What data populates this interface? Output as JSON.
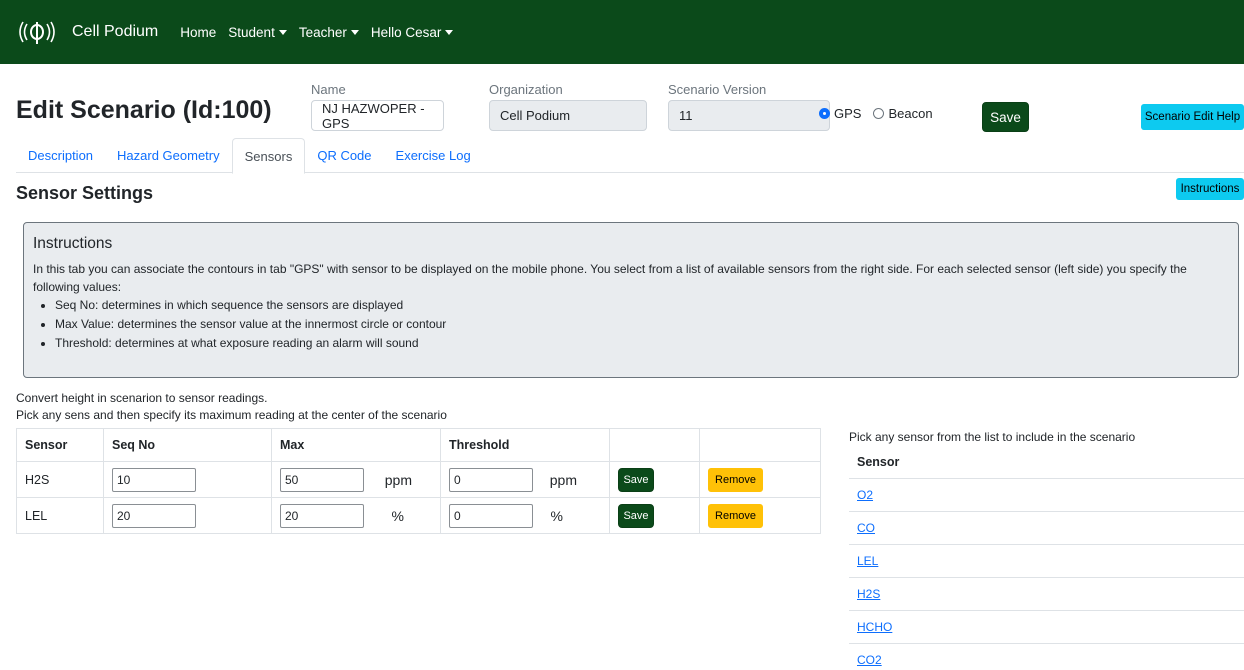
{
  "nav": {
    "brand": "Cell Podium",
    "items": [
      {
        "label": "Home",
        "dropdown": false
      },
      {
        "label": "Student",
        "dropdown": true
      },
      {
        "label": "Teacher",
        "dropdown": true
      },
      {
        "label": "Hello Cesar",
        "dropdown": true
      }
    ],
    "logo_icon": "signal-broadcast-icon"
  },
  "header": {
    "title": "Edit Scenario (Id:100)",
    "name_label": "Name",
    "name_value": "NJ HAZWOPER - GPS",
    "org_label": "Organization",
    "org_value": "Cell Podium",
    "version_label": "Scenario Version",
    "version_value": "11",
    "radio_gps": "GPS",
    "radio_beacon": "Beacon",
    "selected_mode": "GPS",
    "save_label": "Save",
    "help_label": "Scenario Edit Help"
  },
  "tabs": [
    {
      "label": "Description",
      "active": false
    },
    {
      "label": "Hazard Geometry",
      "active": false
    },
    {
      "label": "Sensors",
      "active": true
    },
    {
      "label": "QR Code",
      "active": false
    },
    {
      "label": "Exercise Log",
      "active": false
    }
  ],
  "section": {
    "title": "Sensor Settings",
    "instructions_button": "Instructions"
  },
  "instructions": {
    "title": "Instructions",
    "text": "In this tab you can associate the contours in tab \"GPS\" with sensor to be displayed on the mobile phone. You select from a list of available sensors from the right side. For each selected sensor (left side) you specify the following values:",
    "bullets": [
      "Seq No: determines in which sequence the sensors are displayed",
      "Max Value: determines the sensor value at the innermost circle or contour",
      "Threshold: determines at what exposure reading an alarm will sound"
    ]
  },
  "convert": {
    "line1": "Convert height in scenarion to sensor readings.",
    "line2": "Pick any sens and then specify its maximum reading at the center of the scenario"
  },
  "sensor_table": {
    "headers": [
      "Sensor",
      "Seq No",
      "Max",
      "Threshold",
      "",
      ""
    ],
    "rows": [
      {
        "sensor": "H2S",
        "seq": "10",
        "max": "50",
        "max_unit": "ppm",
        "threshold": "0",
        "threshold_unit": "ppm",
        "save": "Save",
        "remove": "Remove"
      },
      {
        "sensor": "LEL",
        "seq": "20",
        "max": "20",
        "max_unit": "%",
        "threshold": "0",
        "threshold_unit": "%",
        "save": "Save",
        "remove": "Remove"
      }
    ]
  },
  "available": {
    "caption": "Pick any sensor from the list to include in the scenario",
    "header": "Sensor",
    "items": [
      "O2",
      "CO",
      "LEL",
      "H2S",
      "HCHO",
      "CO2"
    ]
  },
  "colors": {
    "navbar": "#0b4a1a",
    "link": "#0d6efd",
    "cyan_button": "#0dcaf0",
    "yellow_button": "#ffc107"
  }
}
